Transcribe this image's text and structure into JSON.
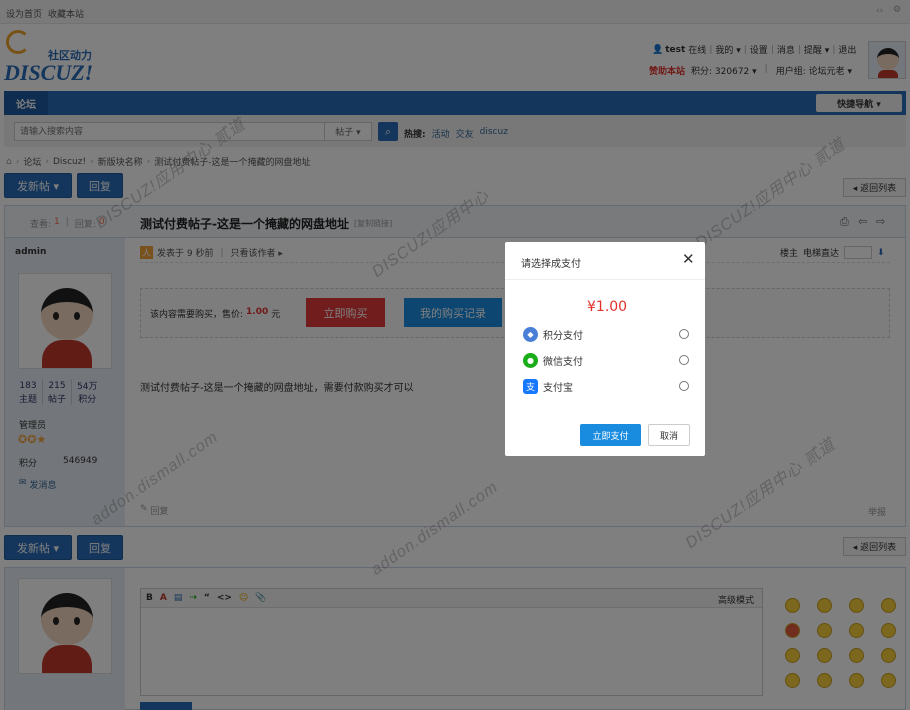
{
  "topbar": {
    "set_home": "设为首页",
    "bookmark": "收藏本站",
    "icons": [
      "code-icon",
      "settings-icon"
    ]
  },
  "logo": {
    "line1": "社区动力",
    "line2": "DISCUZ!"
  },
  "user": {
    "name": "test",
    "status": "在线",
    "links": [
      "我的 ▾",
      "设置",
      "消息",
      "提醒 ▾",
      "退出"
    ],
    "sponsor": "赞助本站",
    "points_label": "积分: 320672 ▾",
    "group": "用户组: 论坛元老 ▾"
  },
  "nav": {
    "forum_tab": "论坛",
    "quick_nav": "快捷导航 ▾"
  },
  "search": {
    "placeholder": "请输入搜索内容",
    "type_select": "帖子 ▾",
    "hot_label": "热搜:",
    "hot_terms": [
      "活动",
      "交友",
      "discuz"
    ]
  },
  "breadcrumb": [
    "论坛",
    "Discuz!",
    "新版块名称",
    "测试付费帖子-这是一个掩藏的网盘地址"
  ],
  "actions": {
    "new_post": "发新帖 ▾",
    "reply": "回复",
    "back_to_list": "◂ 返回列表"
  },
  "thread": {
    "views_label": "查看:",
    "views": "1",
    "replies_label": "回复:",
    "replies": "0",
    "title": "测试付费帖子-这是一个掩藏的网盘地址",
    "copy_link": "[复制链接]",
    "author": "admin",
    "posted": "发表于 9 秒前",
    "only_author": "只看该作者 ▸",
    "floor_label": "楼主",
    "jump_label": "电梯直达",
    "pay_notice": "该内容需要购买，售价:",
    "price": "1.00",
    "price_unit": "元",
    "buy_button": "立即购买",
    "records_button": "我的购买记录",
    "body": "测试付费帖子-这是一个掩藏的网盘地址，需要付款购买才可以",
    "report": "举报",
    "review": "回复"
  },
  "profile": {
    "stats": [
      {
        "value": "183",
        "label": "主题"
      },
      {
        "value": "215",
        "label": "帖子"
      },
      {
        "value": "54万",
        "label": "积分"
      }
    ],
    "role": "管理员",
    "points_label": "积分",
    "points": "546949",
    "send_message": "发消息"
  },
  "editor": {
    "advanced": "高级模式",
    "toolbar": [
      "B",
      "A",
      "▤",
      "⇢",
      "“",
      "<>",
      "☺",
      "📎"
    ]
  },
  "watermark": {
    "brand": "DISCUZ!应用中心",
    "domain": "addon.dismall.com",
    "mark": "贰道"
  },
  "modal": {
    "title": "请选择成支付",
    "amount": "¥1.00",
    "options": [
      {
        "label": "积分支付",
        "icon": "points-pay-icon",
        "color": "#4a7fd8"
      },
      {
        "label": "微信支付",
        "icon": "wechat-pay-icon",
        "color": "#1aad19"
      },
      {
        "label": "支付宝",
        "icon": "alipay-icon",
        "color": "#1677ff"
      }
    ],
    "pay_button": "立即支付",
    "cancel_button": "取消"
  }
}
